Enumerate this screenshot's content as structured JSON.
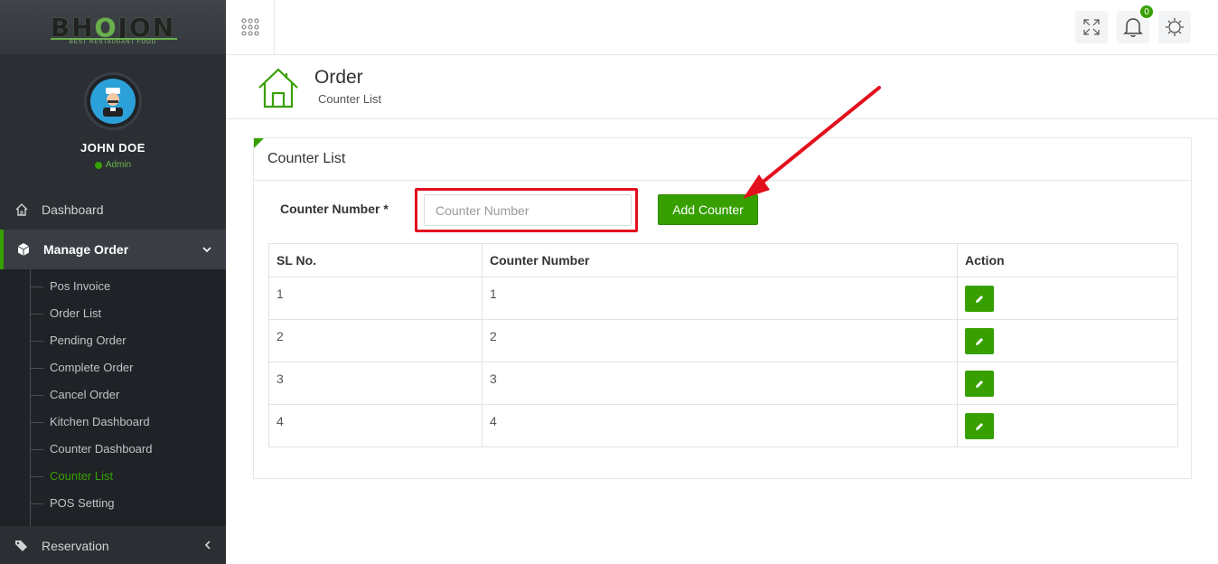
{
  "app": {
    "logo_text_left": "BH",
    "logo_text_accent": "O",
    "logo_text_right": "JON",
    "logo_tagline": "BEST RESTAURANT FOOD"
  },
  "user": {
    "name": "JOHN DOE",
    "role": "Admin"
  },
  "sidebar": {
    "items": [
      {
        "label": "Dashboard",
        "icon": "home-icon"
      },
      {
        "label": "Manage Order",
        "icon": "cube-icon"
      },
      {
        "label": "Reservation",
        "icon": "tags-icon"
      }
    ],
    "submenu": [
      {
        "label": "Pos Invoice"
      },
      {
        "label": "Order List"
      },
      {
        "label": "Pending Order"
      },
      {
        "label": "Complete Order"
      },
      {
        "label": "Cancel Order"
      },
      {
        "label": "Kitchen Dashboard"
      },
      {
        "label": "Counter Dashboard"
      },
      {
        "label": "Counter List"
      },
      {
        "label": "POS Setting"
      }
    ]
  },
  "topbar": {
    "notification_count": "0"
  },
  "header": {
    "title": "Order",
    "subtitle": "Counter List"
  },
  "panel": {
    "title": "Counter List",
    "form": {
      "label": "Counter Number *",
      "input_value": "",
      "input_placeholder": "Counter Number",
      "submit_label": "Add Counter"
    },
    "table": {
      "columns": [
        "SL No.",
        "Counter Number",
        "Action"
      ],
      "rows": [
        {
          "sl": "1",
          "counter": "1"
        },
        {
          "sl": "2",
          "counter": "2"
        },
        {
          "sl": "3",
          "counter": "3"
        },
        {
          "sl": "4",
          "counter": "4"
        }
      ]
    }
  },
  "colors": {
    "accent": "#37a000",
    "sidebar_bg": "#2b2f34",
    "annotation_red": "#e3101e"
  }
}
